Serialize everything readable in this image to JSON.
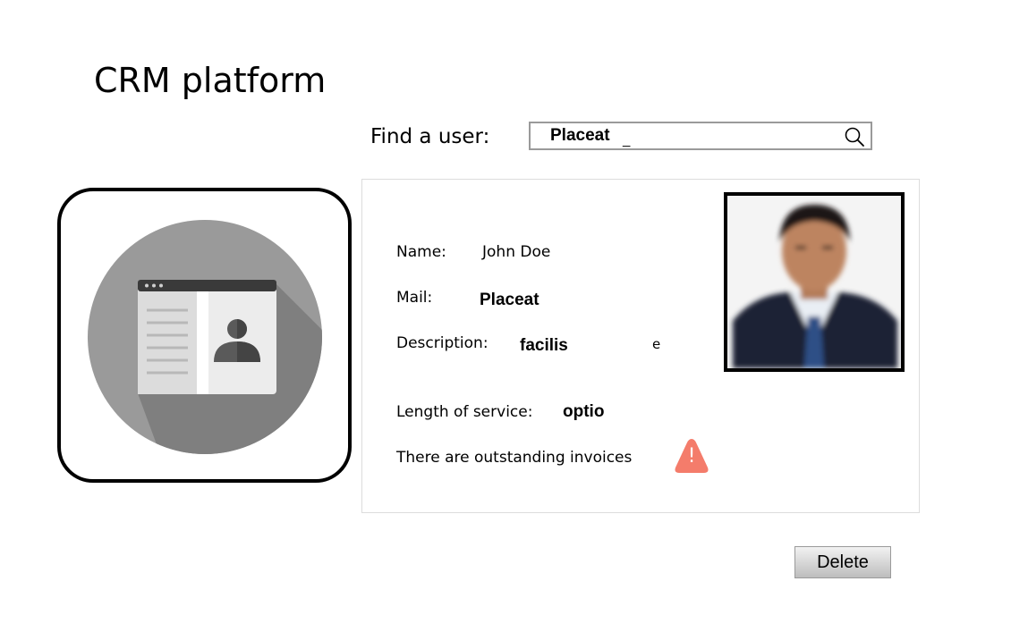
{
  "app": {
    "title": "CRM platform"
  },
  "search": {
    "label": "Find a user:",
    "value": "Placeat",
    "cursor": "_"
  },
  "profile": {
    "name_label": "Name:",
    "name_value": "John Doe",
    "mail_label": "Mail:",
    "mail_value": "Placeat",
    "description_label": "Description:",
    "description_value": "facilis",
    "description_trailing": "e",
    "service_label": "Length of service:",
    "service_value": "optio",
    "invoice_notice": "There are outstanding invoices",
    "warning_glyph": "!"
  },
  "actions": {
    "delete_label": "Delete"
  },
  "icons": {
    "search": "search-icon",
    "app_icon": "contact-card-icon",
    "warning": "warning-icon",
    "photo": "user-photo"
  },
  "colors": {
    "warning": "#f47c6b",
    "icon_circle": "#9a9a9a",
    "button_top": "#f2f2f2",
    "button_bottom": "#bdbdbd"
  }
}
